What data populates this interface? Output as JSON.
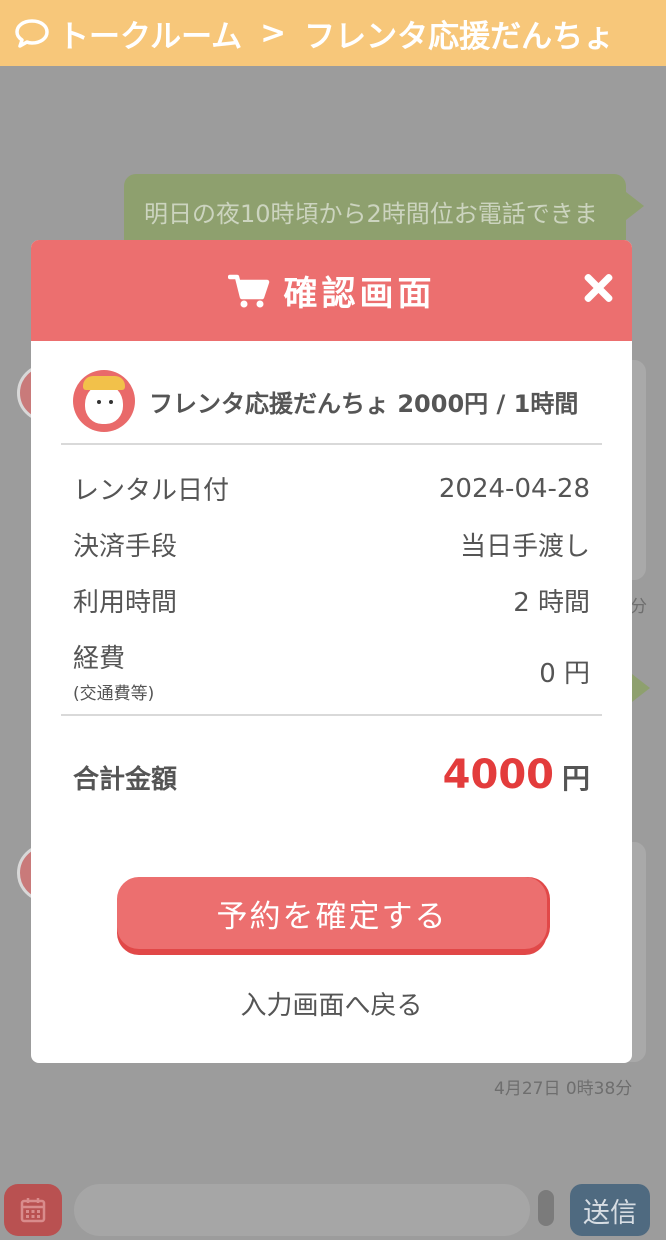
{
  "header": {
    "title_prefix": "トークルーム",
    "separator": ">",
    "title_suffix": "フレンタ応援だんちょ",
    "bg_color": "#f7c77a"
  },
  "chat": {
    "message_preview": "明日の夜10時頃から2時間位お電話できますか",
    "time_partial": "分",
    "last_time": "4月27日 0時38分"
  },
  "modal": {
    "title": "確認画面",
    "header_color": "#ec6f6f",
    "product": "フレンタ応援だんちょ 2000円 / 1時間",
    "rows": [
      {
        "label": "レンタル日付",
        "value": "2024-04-28"
      },
      {
        "label": "決済手段",
        "value": "当日手渡し"
      },
      {
        "label": "利用時間",
        "value": "2 時間"
      },
      {
        "label": "経費",
        "sublabel": "(交通費等)",
        "value": "0 円"
      }
    ],
    "total_label": "合計金額",
    "total_amount": "4000",
    "total_unit": "円",
    "confirm_label": "予約を確定する",
    "back_label": "入力画面へ戻る"
  },
  "bottom_bar": {
    "send_label": "送信"
  }
}
